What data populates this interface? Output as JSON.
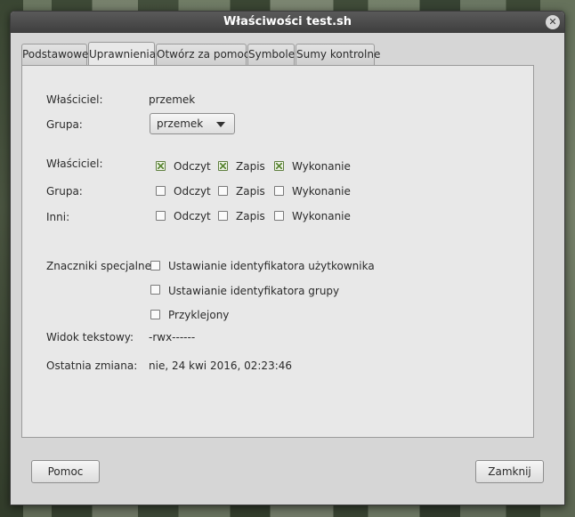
{
  "window": {
    "title": "Właściwości test.sh",
    "close_symbol": "✕"
  },
  "tabs": [
    {
      "label": "Podstawowe",
      "active": false
    },
    {
      "label": "Uprawnienia",
      "active": true
    },
    {
      "label": "Otwórz za pomocą",
      "active": false
    },
    {
      "label": "Symbole",
      "active": false
    },
    {
      "label": "Sumy kontrolne",
      "active": false
    }
  ],
  "ownership": {
    "owner_label": "Właściciel:",
    "owner_value": "przemek",
    "group_label": "Grupa:",
    "group_value": "przemek"
  },
  "permissions": {
    "columns": [
      "Odczyt",
      "Zapis",
      "Wykonanie"
    ],
    "rows": [
      {
        "label": "Właściciel:",
        "checked": [
          true,
          true,
          true
        ]
      },
      {
        "label": "Grupa:",
        "checked": [
          false,
          false,
          false
        ]
      },
      {
        "label": "Inni:",
        "checked": [
          false,
          false,
          false
        ]
      }
    ]
  },
  "special": {
    "label": "Znaczniki specjalne:",
    "flags": [
      {
        "label": "Ustawianie identyfikatora użytkownika",
        "checked": false
      },
      {
        "label": "Ustawianie identyfikatora grupy",
        "checked": false
      },
      {
        "label": "Przyklejony",
        "checked": false
      }
    ]
  },
  "text_view": {
    "label": "Widok tekstowy:",
    "value": "-rwx------"
  },
  "last_change": {
    "label": "Ostatnia zmiana:",
    "value": "nie, 24 kwi 2016, 02:23:46"
  },
  "buttons": {
    "help": "Pomoc",
    "close": "Zamknij"
  }
}
